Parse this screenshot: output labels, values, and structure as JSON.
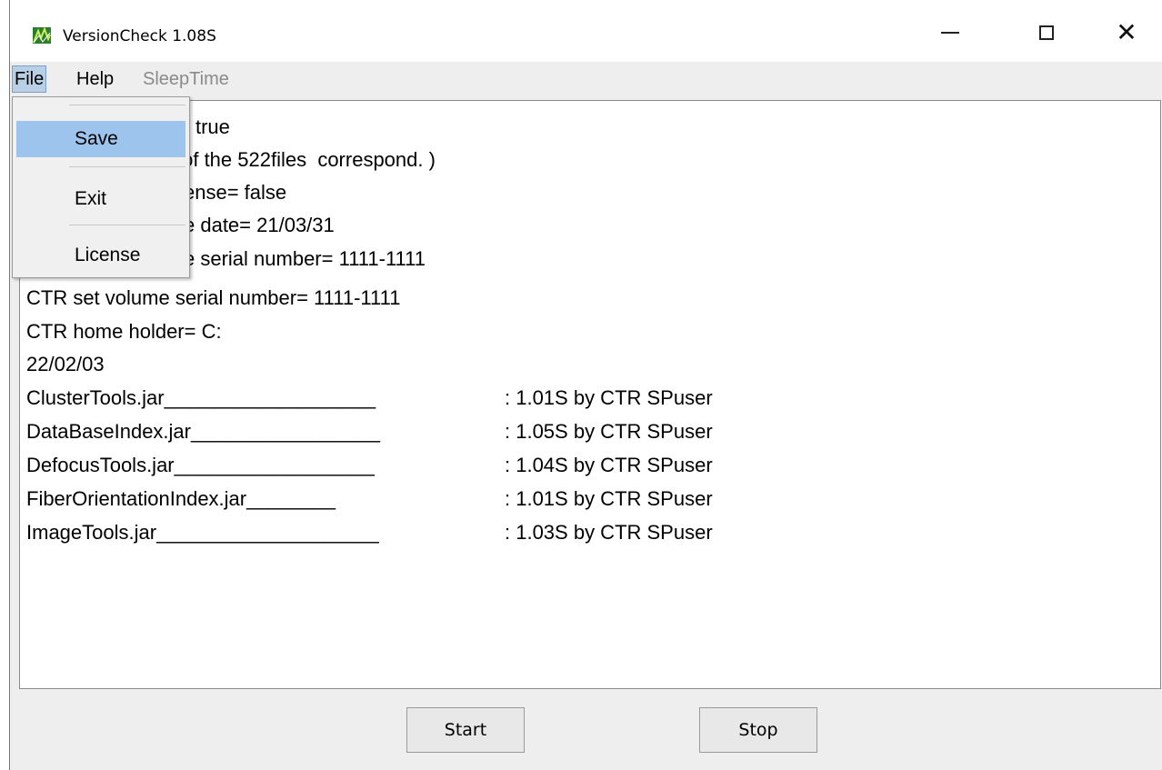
{
  "window": {
    "title": "VersionCheck 1.08S"
  },
  "menubar": {
    "file": "File",
    "help": "Help",
    "sleeptime": "SleepTime"
  },
  "file_menu": {
    "items": [
      {
        "label": "Save"
      },
      {
        "label": "Exit"
      },
      {
        "label": "License"
      }
    ]
  },
  "output": {
    "lines": [
      "= true",
      " of the 522files  correspond. )",
      "ense= false",
      "e date= 21/03/31",
      "e serial number= 1111-1111",
      "CTR set volume serial number= 1111-1111",
      "CTR home holder= C:",
      "22/02/03"
    ],
    "jars": [
      {
        "name": "ClusterTools.jar___________________",
        "version": ": 1.01S by CTR SPuser"
      },
      {
        "name": "DataBaseIndex.jar_________________",
        "version": ": 1.05S by CTR SPuser"
      },
      {
        "name": "DefocusTools.jar__________________",
        "version": ": 1.04S by CTR SPuser"
      },
      {
        "name": "FiberOrientationIndex.jar________",
        "version": ": 1.01S by CTR SPuser"
      },
      {
        "name": "ImageTools.jar____________________",
        "version": ": 1.03S by CTR SPuser"
      }
    ]
  },
  "buttons": {
    "start": "Start",
    "stop": "Stop"
  }
}
